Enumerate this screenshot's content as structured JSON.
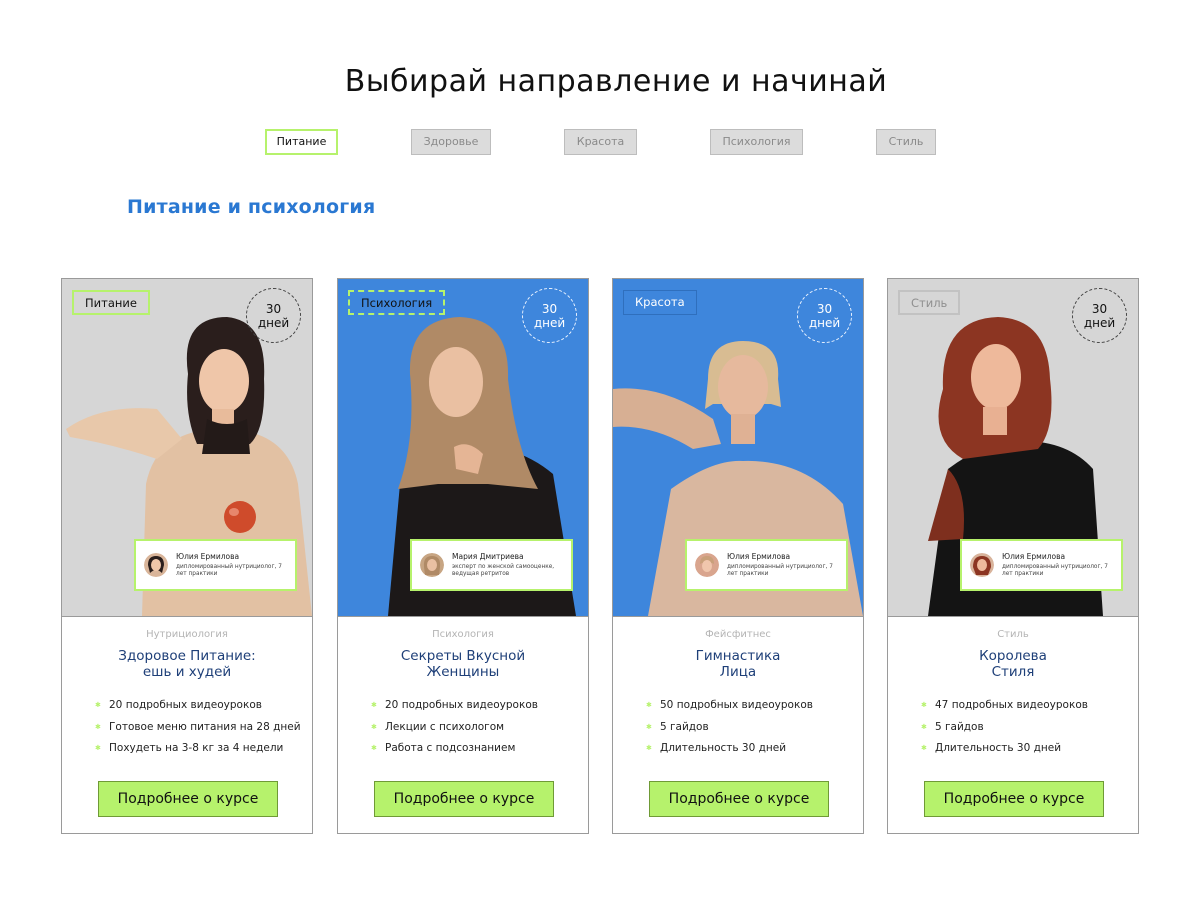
{
  "page": {
    "title": "Выбирай направление и начинай",
    "section_title": "Питание и психология"
  },
  "tabs": [
    {
      "label": "Питание",
      "active": true
    },
    {
      "label": "Здоровье",
      "active": false
    },
    {
      "label": "Красота",
      "active": false
    },
    {
      "label": "Психология",
      "active": false
    },
    {
      "label": "Стиль",
      "active": false
    }
  ],
  "cards": [
    {
      "tag": "Питание",
      "days_number": "30",
      "days_word": "дней",
      "hero_color": "#d6d6d6",
      "author": {
        "name": "Юлия Ермилова",
        "role": "дипломированный нутрициолог, 7 лет практики"
      },
      "category": "Нутрициология",
      "title_line1": "Здоровое Питание:",
      "title_line2": "ешь и худей",
      "features": [
        "20  подробных видеоуроков",
        "Готовое меню питания на 28 дней",
        "Похудеть на 3-8 кг за 4 недели"
      ],
      "button": "Подробнее о курсе"
    },
    {
      "tag": "Психология",
      "days_number": "30",
      "days_word": "дней",
      "hero_color": "#3e86dc",
      "author": {
        "name": "Мария Дмитриева",
        "role": "эксперт по женской самооценке, ведущая ретритов"
      },
      "category": "Психология",
      "title_line1": "Секреты Вкусной",
      "title_line2": "Женщины",
      "features": [
        "20  подробных видеоуроков",
        "Лекции с психологом",
        "Работа с подсознанием"
      ],
      "button": "Подробнее о курсе"
    },
    {
      "tag": "Красота",
      "days_number": "30",
      "days_word": "дней",
      "hero_color": "#3e86dc",
      "author": {
        "name": "Юлия Ермилова",
        "role": "дипломированный нутрициолог, 7 лет практики"
      },
      "category": "Фейсфитнес",
      "title_line1": "Гимнастика",
      "title_line2": "Лица",
      "features": [
        "50 подробных видеоуроков",
        "5 гайдов",
        "Длительность 30 дней"
      ],
      "button": "Подробнее о курсе"
    },
    {
      "tag": "Стиль",
      "days_number": "30",
      "days_word": "дней",
      "hero_color": "#d6d6d6",
      "author": {
        "name": "Юлия Ермилова",
        "role": "дипломированный нутрициолог, 7 лет практики"
      },
      "category": "Стиль",
      "title_line1": "Королева",
      "title_line2": "Стиля",
      "features": [
        "47 подробных видеоуроков",
        "5 гайдов",
        "Длительность 30 дней"
      ],
      "button": "Подробнее о курсе"
    }
  ],
  "colors": {
    "accent_green": "#b6f26c",
    "accent_blue": "#2a78d2",
    "hero_blue": "#3e86dc",
    "hero_gray": "#d6d6d6",
    "title_navy": "#1e3f78"
  }
}
